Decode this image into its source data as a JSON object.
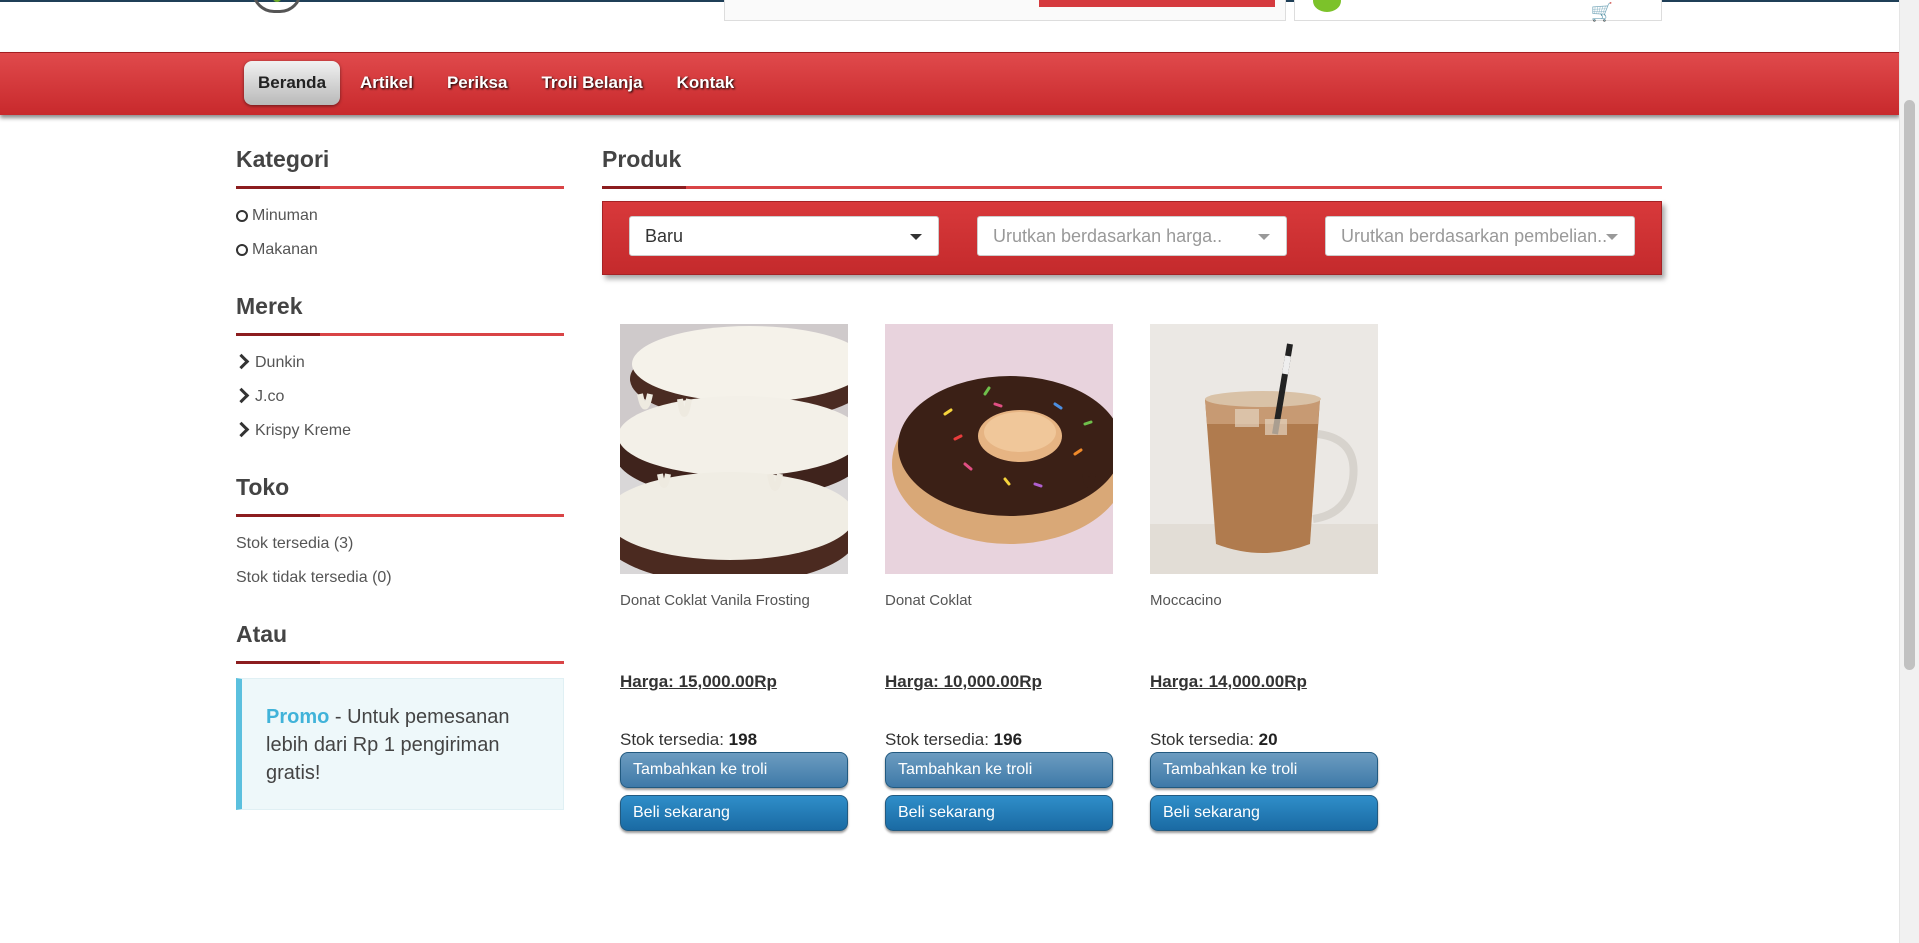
{
  "nav": {
    "items": [
      {
        "label": "Beranda",
        "active": true
      },
      {
        "label": "Artikel"
      },
      {
        "label": "Periksa"
      },
      {
        "label": "Troli Belanja"
      },
      {
        "label": "Kontak"
      }
    ]
  },
  "sidebar": {
    "kategori": {
      "title": "Kategori",
      "items": [
        "Minuman",
        "Makanan"
      ]
    },
    "merek": {
      "title": "Merek",
      "items": [
        "Dunkin",
        "J.co",
        "Krispy Kreme"
      ]
    },
    "toko": {
      "title": "Toko",
      "items": [
        "Stok tersedia (3)",
        "Stok tidak tersedia (0)"
      ]
    },
    "atau": {
      "title": "Atau"
    },
    "promo": {
      "label": "Promo",
      "text": " - Untuk pemesanan lebih dari Rp 1 pengiriman gratis!"
    }
  },
  "main": {
    "title": "Produk",
    "filters": {
      "newest": "Baru",
      "price_placeholder": "Urutkan berdasarkan harga..",
      "purchase_placeholder": "Urutkan berdasarkan pembelian.."
    },
    "products": [
      {
        "name": "Donat Coklat Vanila Frosting",
        "price": "Harga: 15,000.00Rp",
        "stock_label": "Stok tersedia: ",
        "stock": "198",
        "add_label": "Tambahkan ke troli",
        "buy_label": "Beli sekarang"
      },
      {
        "name": "Donat Coklat",
        "price": "Harga: 10,000.00Rp",
        "stock_label": "Stok tersedia: ",
        "stock": "196",
        "add_label": "Tambahkan ke troli",
        "buy_label": "Beli sekarang"
      },
      {
        "name": "Moccacino",
        "price": "Harga: 14,000.00Rp",
        "stock_label": "Stok tersedia: ",
        "stock": "20",
        "add_label": "Tambahkan ke troli",
        "buy_label": "Beli sekarang"
      }
    ]
  },
  "colors": {
    "nav_red": "#d53a3e",
    "button_blue": "#1a6aa3",
    "promo_accent": "#5bc0de"
  }
}
